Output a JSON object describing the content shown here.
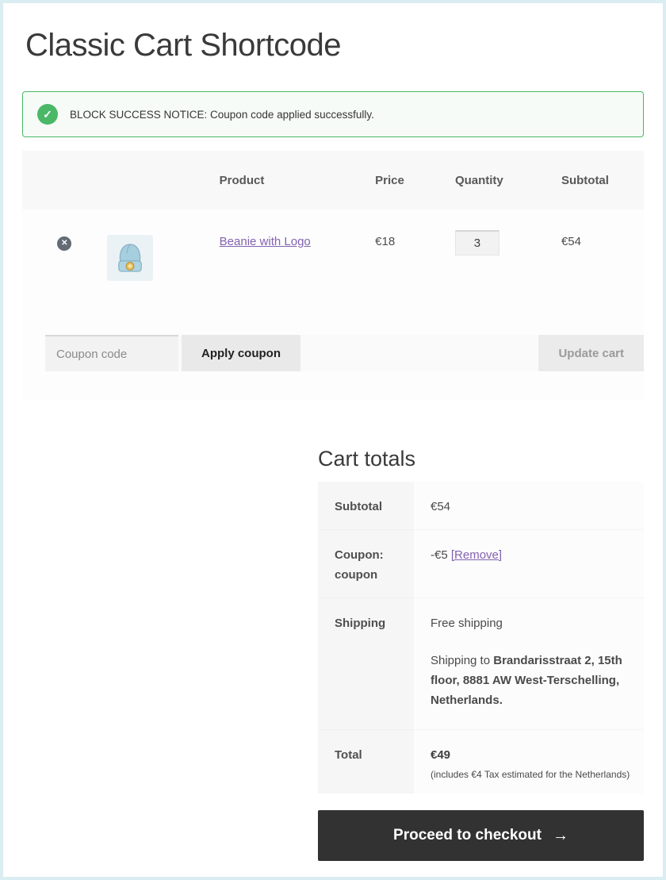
{
  "icons": {
    "check": "✓",
    "remove": "✕",
    "arrow_right": "→"
  },
  "page": {
    "title": "Classic Cart Shortcode"
  },
  "notice": {
    "message": "BLOCK SUCCESS NOTICE: Coupon code applied successfully."
  },
  "cart": {
    "headers": {
      "product": "Product",
      "price": "Price",
      "quantity": "Quantity",
      "subtotal": "Subtotal"
    },
    "items": [
      {
        "name": "Beanie with Logo",
        "price": "€18",
        "quantity": "3",
        "subtotal": "€54"
      }
    ],
    "coupon_placeholder": "Coupon code",
    "apply_coupon_label": "Apply coupon",
    "update_cart_label": "Update cart"
  },
  "totals": {
    "heading": "Cart totals",
    "subtotal_label": "Subtotal",
    "subtotal_value": "€54",
    "coupon_label": "Coupon: coupon",
    "coupon_value": "-€5",
    "coupon_remove_label": "[Remove]",
    "shipping_label": "Shipping",
    "shipping_method": "Free shipping",
    "shipping_to_prefix": "Shipping to ",
    "shipping_address": "Brandarisstraat 2, 15th floor, 8881 AW West-Terschelling, Netherlands.",
    "total_label": "Total",
    "total_value": "€49",
    "total_note": "(includes €4 Tax estimated for the Netherlands)",
    "checkout_label": "Proceed to checkout"
  },
  "colors": {
    "success_green": "#4ab866",
    "accent_purple": "#8262b1",
    "button_dark": "#323232",
    "page_border": "#d9edf2"
  }
}
